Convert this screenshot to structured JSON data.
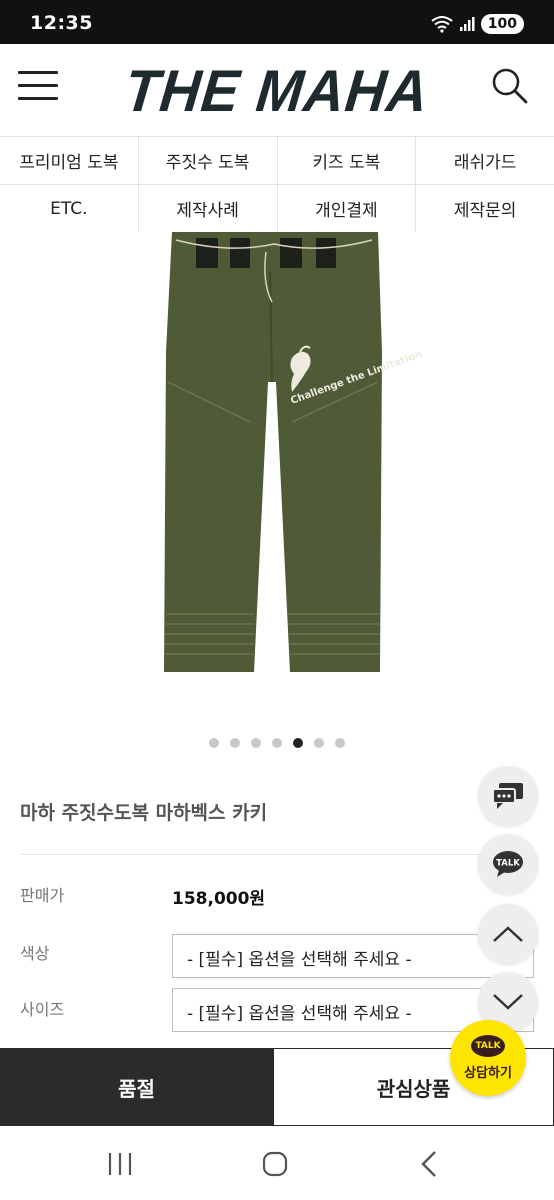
{
  "status_bar": {
    "time": "12:35",
    "battery": "100",
    "icons": [
      "wifi-icon",
      "signal-icon",
      "battery-icon"
    ]
  },
  "header": {
    "logo_text": "THE MAHA",
    "menu_icon": "hamburger-menu-icon",
    "search_icon": "search-icon"
  },
  "categories": {
    "row1": [
      "프리미엄 도복",
      "주짓수 도복",
      "키즈 도복",
      "래쉬가드"
    ],
    "row2": [
      "ETC.",
      "제작사례",
      "개인결제",
      "제작문의"
    ]
  },
  "product_image": {
    "print_text": "Challenge the Limitation"
  },
  "carousel": {
    "total": 7,
    "active_index": 4
  },
  "product": {
    "title": "마하 주짓수도복 마하벡스 카키",
    "price_label": "판매가",
    "price_value": "158,000원",
    "color_label": "색상",
    "color_select": "- [필수] 옵션을 선택해 주세요 -",
    "size_label": "사이즈",
    "size_select": "- [필수] 옵션을 선택해 주세요 -"
  },
  "floating": {
    "chat_icon": "chat-bubble-icon",
    "talk_icon_text": "TALK",
    "scroll_up_icon": "chevron-up-icon",
    "scroll_down_icon": "chevron-down-icon",
    "kakao_badge_bubble": "TALK",
    "kakao_badge_label": "상담하기"
  },
  "actions": {
    "soldout_label": "품절",
    "wishlist_label": "관심상품"
  },
  "colors": {
    "accent_dark": "#2b2b2b",
    "kakao_yellow": "#fee500",
    "khaki": "#4f5b36"
  }
}
